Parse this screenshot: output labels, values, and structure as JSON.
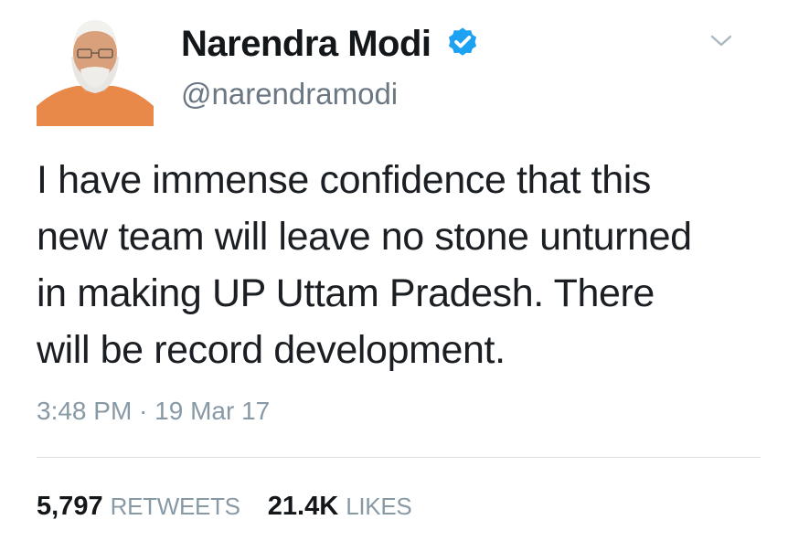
{
  "author": {
    "name": "Narendra Modi",
    "handle": "@narendramodi",
    "verified": true,
    "verified_icon": "verified-badge-icon"
  },
  "tweet": {
    "lines": [
      "I have immense confidence that this",
      "new team will leave no stone unturned",
      "in making UP Uttam Pradesh. There",
      "will be record development."
    ],
    "timestamp": "3:48 PM · 19 Mar 17"
  },
  "stats": {
    "retweets_count": "5,797",
    "retweets_label": "RETWEETS",
    "likes_count": "21.4K",
    "likes_label": "LIKES"
  },
  "menu_icon": "chevron-down-icon",
  "colors": {
    "verified_blue": "#1da1f2",
    "muted_gray": "#8899a6",
    "text_dark": "#14171a"
  }
}
